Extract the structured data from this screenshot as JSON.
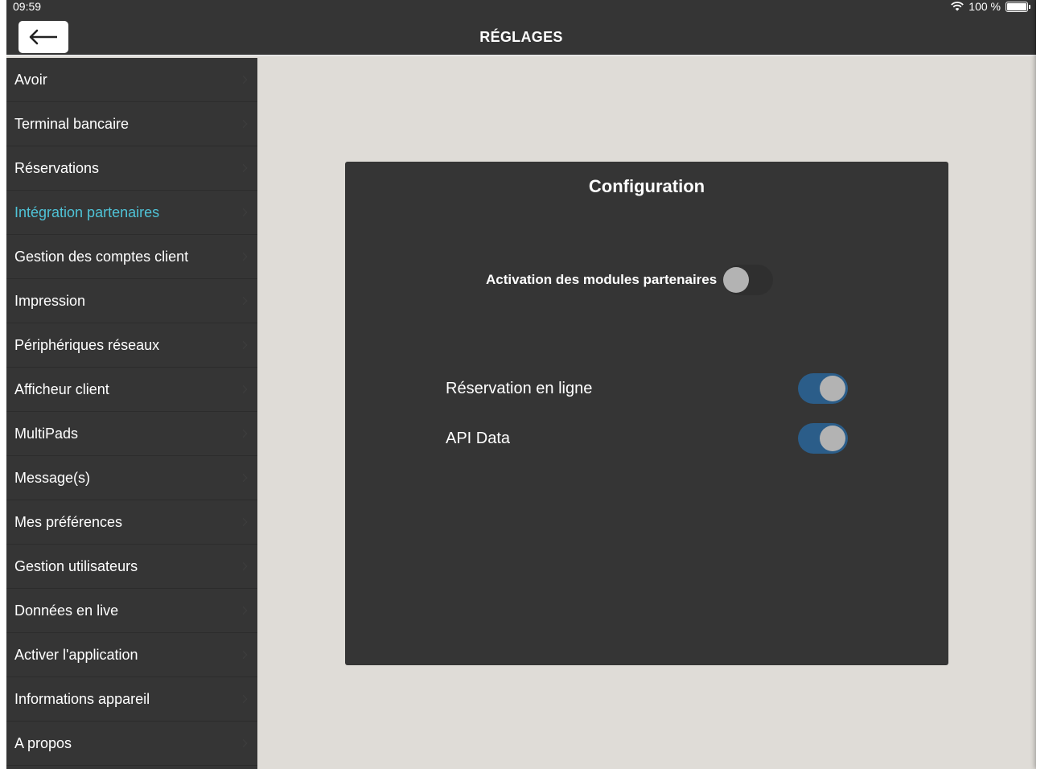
{
  "status_bar": {
    "time": "09:59",
    "battery_text": "100 %"
  },
  "nav": {
    "title": "RÉGLAGES",
    "back_icon": "arrow-left-icon"
  },
  "sidebar": {
    "items": [
      {
        "label": "Avoir",
        "active": false
      },
      {
        "label": "Terminal bancaire",
        "active": false
      },
      {
        "label": "Réservations",
        "active": false
      },
      {
        "label": "Intégration partenaires",
        "active": true
      },
      {
        "label": "Gestion des comptes client",
        "active": false
      },
      {
        "label": "Impression",
        "active": false
      },
      {
        "label": "Périphériques réseaux",
        "active": false
      },
      {
        "label": "Afficheur client",
        "active": false
      },
      {
        "label": "MultiPads",
        "active": false
      },
      {
        "label": "Message(s)",
        "active": false
      },
      {
        "label": "Mes préférences",
        "active": false
      },
      {
        "label": "Gestion utilisateurs",
        "active": false
      },
      {
        "label": "Données en live",
        "active": false
      },
      {
        "label": "Activer l'application",
        "active": false
      },
      {
        "label": "Informations appareil",
        "active": false
      },
      {
        "label": "A propos",
        "active": false
      }
    ]
  },
  "panel": {
    "title": "Configuration",
    "master_toggle": {
      "label": "Activation des modules partenaires",
      "on": false
    },
    "options": [
      {
        "label": "Réservation en ligne",
        "on": true
      },
      {
        "label": "API Data",
        "on": true
      }
    ]
  },
  "colors": {
    "accent": "#4fc3d7",
    "toggle_on": "#2b5d89",
    "chrome": "#353535",
    "background": "#dfdcd7"
  }
}
